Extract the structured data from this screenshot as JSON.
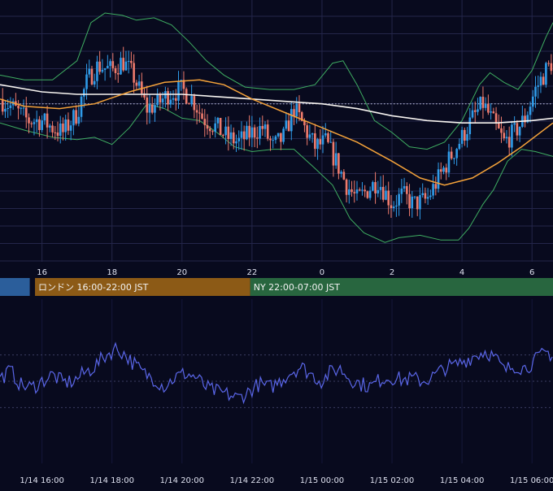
{
  "chart_data": [
    {
      "type": "candlestick",
      "panel": "price",
      "x_hours": [
        15.0,
        21.5
      ],
      "x_range_hours": [
        14.8,
        30.6
      ],
      "y_range": [
        0.0,
        1.0
      ],
      "hour_ticks": [
        {
          "hour": 16,
          "label": "16"
        },
        {
          "hour": 18,
          "label": "18"
        },
        {
          "hour": 20,
          "label": "20"
        },
        {
          "hour": 22,
          "label": "22"
        },
        {
          "hour": 24,
          "label": "0"
        },
        {
          "hour": 26,
          "label": "2"
        },
        {
          "hour": 28,
          "label": "4"
        },
        {
          "hour": 30,
          "label": "6"
        }
      ],
      "reference_line": 0.62,
      "close_path": [
        [
          14.8,
          0.64
        ],
        [
          15.2,
          0.6
        ],
        [
          15.6,
          0.55
        ],
        [
          16.0,
          0.55
        ],
        [
          16.3,
          0.52
        ],
        [
          16.6,
          0.5
        ],
        [
          17.0,
          0.58
        ],
        [
          17.3,
          0.72
        ],
        [
          17.6,
          0.78
        ],
        [
          18.0,
          0.76
        ],
        [
          18.3,
          0.8
        ],
        [
          18.6,
          0.74
        ],
        [
          19.0,
          0.6
        ],
        [
          19.3,
          0.62
        ],
        [
          19.6,
          0.66
        ],
        [
          20.0,
          0.68
        ],
        [
          20.3,
          0.64
        ],
        [
          20.6,
          0.56
        ],
        [
          21.0,
          0.52
        ],
        [
          21.3,
          0.48
        ],
        [
          21.6,
          0.46
        ],
        [
          22.0,
          0.5
        ],
        [
          22.3,
          0.52
        ],
        [
          22.6,
          0.44
        ],
        [
          22.9,
          0.48
        ],
        [
          23.2,
          0.6
        ],
        [
          23.5,
          0.52
        ],
        [
          23.8,
          0.44
        ],
        [
          24.1,
          0.46
        ],
        [
          24.4,
          0.38
        ],
        [
          24.7,
          0.28
        ],
        [
          25.0,
          0.22
        ],
        [
          25.3,
          0.26
        ],
        [
          25.6,
          0.3
        ],
        [
          26.0,
          0.2
        ],
        [
          26.3,
          0.24
        ],
        [
          26.6,
          0.2
        ],
        [
          27.0,
          0.22
        ],
        [
          27.3,
          0.3
        ],
        [
          27.6,
          0.38
        ],
        [
          28.0,
          0.48
        ],
        [
          28.3,
          0.56
        ],
        [
          28.6,
          0.62
        ],
        [
          28.9,
          0.54
        ],
        [
          29.2,
          0.46
        ],
        [
          29.5,
          0.5
        ],
        [
          29.8,
          0.56
        ],
        [
          30.1,
          0.68
        ],
        [
          30.4,
          0.76
        ],
        [
          30.6,
          0.8
        ]
      ],
      "moving_averages": [
        {
          "color": "#f7f4f0",
          "values": [
            [
              14.8,
              0.7
            ],
            [
              16.0,
              0.67
            ],
            [
              17.0,
              0.66
            ],
            [
              18.0,
              0.66
            ],
            [
              19.0,
              0.66
            ],
            [
              20.0,
              0.66
            ],
            [
              21.0,
              0.65
            ],
            [
              22.0,
              0.64
            ],
            [
              23.0,
              0.63
            ],
            [
              24.0,
              0.62
            ],
            [
              25.0,
              0.6
            ],
            [
              26.0,
              0.57
            ],
            [
              27.0,
              0.55
            ],
            [
              28.0,
              0.54
            ],
            [
              29.0,
              0.54
            ],
            [
              30.0,
              0.55
            ],
            [
              30.6,
              0.56
            ]
          ]
        },
        {
          "color": "#f4a23a",
          "values": [
            [
              14.8,
              0.64
            ],
            [
              15.5,
              0.61
            ],
            [
              16.5,
              0.6
            ],
            [
              17.5,
              0.62
            ],
            [
              18.5,
              0.67
            ],
            [
              19.5,
              0.71
            ],
            [
              20.5,
              0.72
            ],
            [
              21.2,
              0.7
            ],
            [
              22.0,
              0.64
            ],
            [
              23.0,
              0.58
            ],
            [
              24.0,
              0.52
            ],
            [
              25.0,
              0.46
            ],
            [
              26.0,
              0.38
            ],
            [
              26.8,
              0.31
            ],
            [
              27.5,
              0.28
            ],
            [
              28.3,
              0.31
            ],
            [
              29.0,
              0.37
            ],
            [
              29.7,
              0.44
            ],
            [
              30.6,
              0.54
            ]
          ]
        }
      ],
      "bands": {
        "color": "#3fae62",
        "upper": [
          [
            14.8,
            0.74
          ],
          [
            15.5,
            0.72
          ],
          [
            16.3,
            0.72
          ],
          [
            17.0,
            0.8
          ],
          [
            17.4,
            0.96
          ],
          [
            17.8,
            1.0
          ],
          [
            18.3,
            0.99
          ],
          [
            18.7,
            0.97
          ],
          [
            19.2,
            0.98
          ],
          [
            19.7,
            0.95
          ],
          [
            20.2,
            0.88
          ],
          [
            20.7,
            0.8
          ],
          [
            21.2,
            0.74
          ],
          [
            21.8,
            0.69
          ],
          [
            22.5,
            0.68
          ],
          [
            23.2,
            0.68
          ],
          [
            23.8,
            0.7
          ],
          [
            24.3,
            0.79
          ],
          [
            24.6,
            0.8
          ],
          [
            25.0,
            0.7
          ],
          [
            25.5,
            0.55
          ],
          [
            26.0,
            0.5
          ],
          [
            26.5,
            0.44
          ],
          [
            27.0,
            0.43
          ],
          [
            27.5,
            0.46
          ],
          [
            28.0,
            0.55
          ],
          [
            28.5,
            0.7
          ],
          [
            28.8,
            0.75
          ],
          [
            29.2,
            0.71
          ],
          [
            29.6,
            0.68
          ],
          [
            30.0,
            0.76
          ],
          [
            30.4,
            0.9
          ],
          [
            30.6,
            0.96
          ]
        ],
        "lower": [
          [
            14.8,
            0.54
          ],
          [
            15.5,
            0.51
          ],
          [
            16.3,
            0.48
          ],
          [
            17.0,
            0.47
          ],
          [
            17.5,
            0.48
          ],
          [
            18.0,
            0.45
          ],
          [
            18.5,
            0.52
          ],
          [
            19.0,
            0.62
          ],
          [
            19.5,
            0.6
          ],
          [
            20.0,
            0.56
          ],
          [
            20.5,
            0.55
          ],
          [
            21.0,
            0.5
          ],
          [
            21.5,
            0.44
          ],
          [
            22.0,
            0.42
          ],
          [
            22.6,
            0.43
          ],
          [
            23.2,
            0.43
          ],
          [
            23.8,
            0.35
          ],
          [
            24.3,
            0.28
          ],
          [
            24.8,
            0.14
          ],
          [
            25.2,
            0.08
          ],
          [
            25.8,
            0.04
          ],
          [
            26.2,
            0.06
          ],
          [
            26.8,
            0.07
          ],
          [
            27.4,
            0.05
          ],
          [
            27.9,
            0.05
          ],
          [
            28.2,
            0.1
          ],
          [
            28.6,
            0.2
          ],
          [
            28.9,
            0.26
          ],
          [
            29.3,
            0.38
          ],
          [
            29.7,
            0.43
          ],
          [
            30.1,
            0.42
          ],
          [
            30.6,
            0.4
          ]
        ]
      }
    },
    {
      "type": "line",
      "panel": "oscillator",
      "x_range_hours": [
        14.8,
        30.6
      ],
      "y_range": [
        0.0,
        1.0
      ],
      "series": [
        {
          "color": "#5a66e8",
          "values": [
            [
              14.8,
              0.52
            ],
            [
              15.1,
              0.58
            ],
            [
              15.4,
              0.47
            ],
            [
              15.7,
              0.45
            ],
            [
              16.0,
              0.5
            ],
            [
              16.3,
              0.55
            ],
            [
              16.6,
              0.49
            ],
            [
              16.9,
              0.5
            ],
            [
              17.2,
              0.56
            ],
            [
              17.5,
              0.61
            ],
            [
              17.8,
              0.69
            ],
            [
              18.1,
              0.75
            ],
            [
              18.3,
              0.72
            ],
            [
              18.6,
              0.64
            ],
            [
              18.9,
              0.56
            ],
            [
              19.2,
              0.52
            ],
            [
              19.5,
              0.46
            ],
            [
              19.8,
              0.53
            ],
            [
              20.1,
              0.56
            ],
            [
              20.4,
              0.53
            ],
            [
              20.7,
              0.45
            ],
            [
              21.0,
              0.42
            ],
            [
              21.3,
              0.4
            ],
            [
              21.6,
              0.37
            ],
            [
              21.9,
              0.42
            ],
            [
              22.2,
              0.48
            ],
            [
              22.5,
              0.45
            ],
            [
              22.8,
              0.5
            ],
            [
              23.1,
              0.57
            ],
            [
              23.4,
              0.61
            ],
            [
              23.7,
              0.55
            ],
            [
              24.0,
              0.5
            ],
            [
              24.2,
              0.56
            ],
            [
              24.5,
              0.6
            ],
            [
              24.8,
              0.52
            ],
            [
              25.1,
              0.48
            ],
            [
              25.4,
              0.46
            ],
            [
              25.7,
              0.52
            ],
            [
              26.0,
              0.53
            ],
            [
              26.3,
              0.51
            ],
            [
              26.6,
              0.52
            ],
            [
              26.9,
              0.5
            ],
            [
              27.2,
              0.54
            ],
            [
              27.5,
              0.6
            ],
            [
              27.8,
              0.62
            ],
            [
              28.1,
              0.66
            ],
            [
              28.4,
              0.7
            ],
            [
              28.7,
              0.73
            ],
            [
              29.0,
              0.66
            ],
            [
              29.2,
              0.58
            ],
            [
              29.5,
              0.62
            ],
            [
              29.8,
              0.6
            ],
            [
              30.1,
              0.66
            ],
            [
              30.4,
              0.72
            ],
            [
              30.6,
              0.7
            ]
          ]
        }
      ]
    }
  ],
  "sessions": [
    {
      "label": "",
      "start_hour": 14.8,
      "end_hour": 15.65,
      "color": "#2b5e9b"
    },
    {
      "label": "ロンドン 16:00-22:00 JST",
      "start_hour": 15.8,
      "end_hour": 21.95,
      "color": "#8c5a16"
    },
    {
      "label": "NY 22:00-07:00 JST",
      "start_hour": 21.95,
      "end_hour": 30.6,
      "color": "#28663f"
    }
  ],
  "time_labels": [
    {
      "hour": 16,
      "label": "1/14 16:00"
    },
    {
      "hour": 18,
      "label": "1/14 18:00"
    },
    {
      "hour": 20,
      "label": "1/14 20:00"
    },
    {
      "hour": 22,
      "label": "1/14 22:00"
    },
    {
      "hour": 24,
      "label": "1/15 00:00"
    },
    {
      "hour": 26,
      "label": "1/15 02:00"
    },
    {
      "hour": 28,
      "label": "1/15 04:00"
    },
    {
      "hour": 30,
      "label": "1/15 06:00"
    }
  ],
  "colors": {
    "background": "#080a1e",
    "grid": "#24264a",
    "bull": "#2f9be8",
    "bear": "#ee7b6d",
    "tick_text": "#dfe2f0"
  }
}
